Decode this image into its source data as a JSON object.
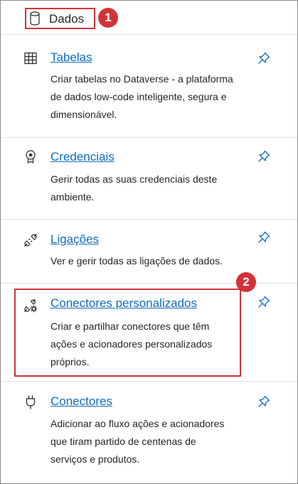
{
  "header": {
    "icon": "database-icon",
    "title": "Dados",
    "badge": "1"
  },
  "callout_badge": "2",
  "items": [
    {
      "icon": "table-grid-icon",
      "title": "Tabelas",
      "desc_lines": [
        "Criar tabelas no Dataverse - a plataforma",
        "de dados low-code inteligente, segura e",
        "dimensionável."
      ],
      "pin_icon": "pin-icon"
    },
    {
      "icon": "credential-badge-icon",
      "title": "Credenciais",
      "desc_lines": [
        "Gerir todas as suas credenciais deste",
        "ambiente."
      ],
      "pin_icon": "pin-icon"
    },
    {
      "icon": "plug-connection-icon",
      "title": "Ligações",
      "desc_lines": [
        "Ver e gerir todas as ligações de dados."
      ],
      "pin_icon": "pin-icon"
    },
    {
      "icon": "custom-connector-icon",
      "title": "Conectores personalizados",
      "desc_lines": [
        "Criar e partilhar conectores que têm",
        "ações e acionadores personalizados",
        "próprios."
      ],
      "pin_icon": "pin-icon"
    },
    {
      "icon": "connector-plug-icon",
      "title": "Conectores",
      "desc_lines": [
        "Adicionar ao fluxo ações e acionadores",
        "que tiram partido de centenas de",
        "serviços e produtos."
      ],
      "pin_icon": "pin-icon"
    }
  ],
  "colors": {
    "accent_link": "#0f6cbd",
    "annotation_red": "#d13438",
    "separator": "#e1e1e1"
  }
}
